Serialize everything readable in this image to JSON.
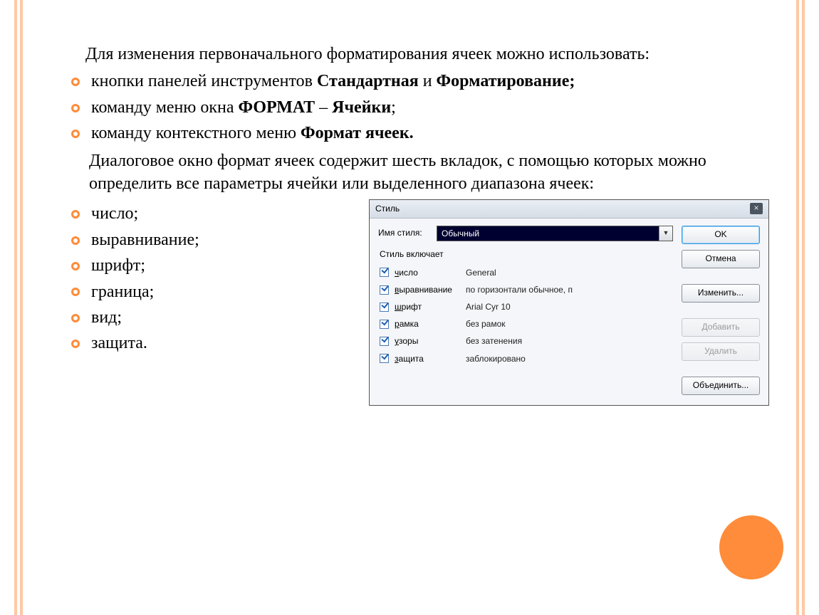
{
  "intro": "Для изменения первоначального форматирования ячеек можно использовать:",
  "bullets_top": [
    {
      "plain": "кнопки панелей инструментов ",
      "bold1": "Стандартная",
      "mid": " и ",
      "bold2": "Форматирование;"
    },
    {
      "plain": "команду меню окна ",
      "bold1": "ФОРМАТ",
      "mid": " – ",
      "bold2": "Ячейки",
      "tail": ";"
    },
    {
      "plain": "команду контекстного меню ",
      "bold1": "Формат ячеек.",
      "mid": "",
      "bold2": ""
    }
  ],
  "para": "Диалоговое окно формат ячеек содержит шесть вкладок, с помощью которых можно определить все параметры ячейки или выделенного диапазона ячеек:",
  "bullets_left": [
    "число;",
    "выравнивание;",
    "шрифт;",
    "граница;",
    "вид;",
    "защита."
  ],
  "dialog": {
    "title": "Стиль",
    "close": "×",
    "name_label": "Имя стиля:",
    "name_value": "Обычный",
    "group_label": "Стиль включает",
    "checks": [
      {
        "u": "ч",
        "rest": "исло",
        "val": "General"
      },
      {
        "u": "в",
        "rest": "ыравнивание",
        "val": "по горизонтали обычное, п"
      },
      {
        "u": "ш",
        "rest": "рифт",
        "val": "Arial Cyr 10"
      },
      {
        "u": "р",
        "rest": "амка",
        "val": "без рамок"
      },
      {
        "u": "у",
        "rest": "зоры",
        "val": "без затенения"
      },
      {
        "u": "з",
        "rest": "ащита",
        "val": "заблокировано"
      }
    ],
    "buttons": {
      "ok": "OK",
      "cancel": "Отмена",
      "modify": "Изменить...",
      "add": "Добавить",
      "delete": "Удалить",
      "merge": "Объединить..."
    }
  }
}
